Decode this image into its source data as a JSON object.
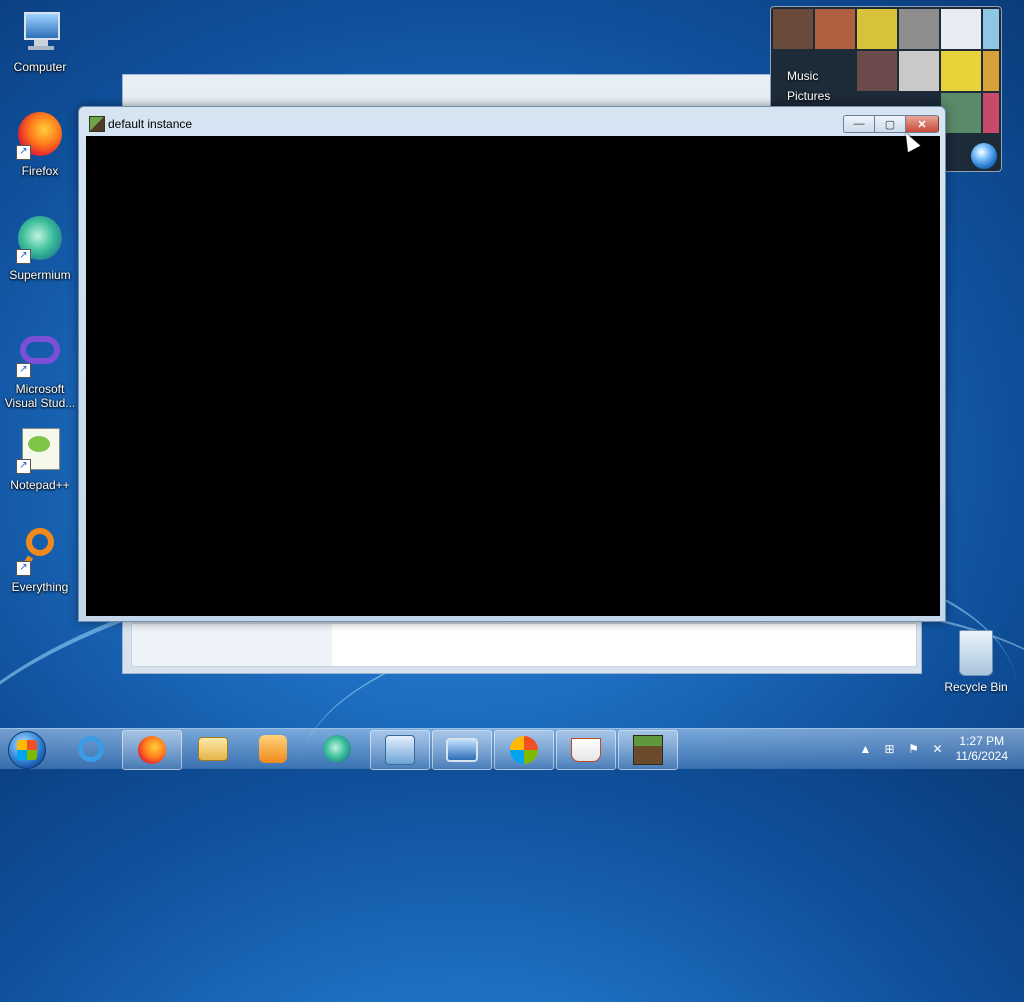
{
  "desktop": {
    "icons": [
      {
        "label": "Computer"
      },
      {
        "label": "Firefox"
      },
      {
        "label": "Supermium"
      },
      {
        "label": "Microsoft Visual Stud..."
      },
      {
        "label": "Notepad++"
      },
      {
        "label": "Everything"
      }
    ],
    "recycle_bin": {
      "label": "Recycle Bin"
    }
  },
  "gadget": {
    "items": [
      "Music",
      "Pictures"
    ]
  },
  "window": {
    "title": "default instance",
    "controls": {
      "minimize": "—",
      "maximize": "▢",
      "close": "✕"
    }
  },
  "taskbar": {
    "pinned": [
      "Internet Explorer",
      "Firefox",
      "File Explorer",
      "Media Player",
      "Supermium",
      "Control Panel",
      "Remote Desktop",
      "Windows Update",
      "Java",
      "Minecraft"
    ],
    "tray": {
      "time": "1:27 PM",
      "date": "11/6/2024"
    }
  },
  "colors": {
    "desktop_bg": "#1f70c4",
    "window_content": "#000000",
    "close_button": "#c84a3a"
  }
}
